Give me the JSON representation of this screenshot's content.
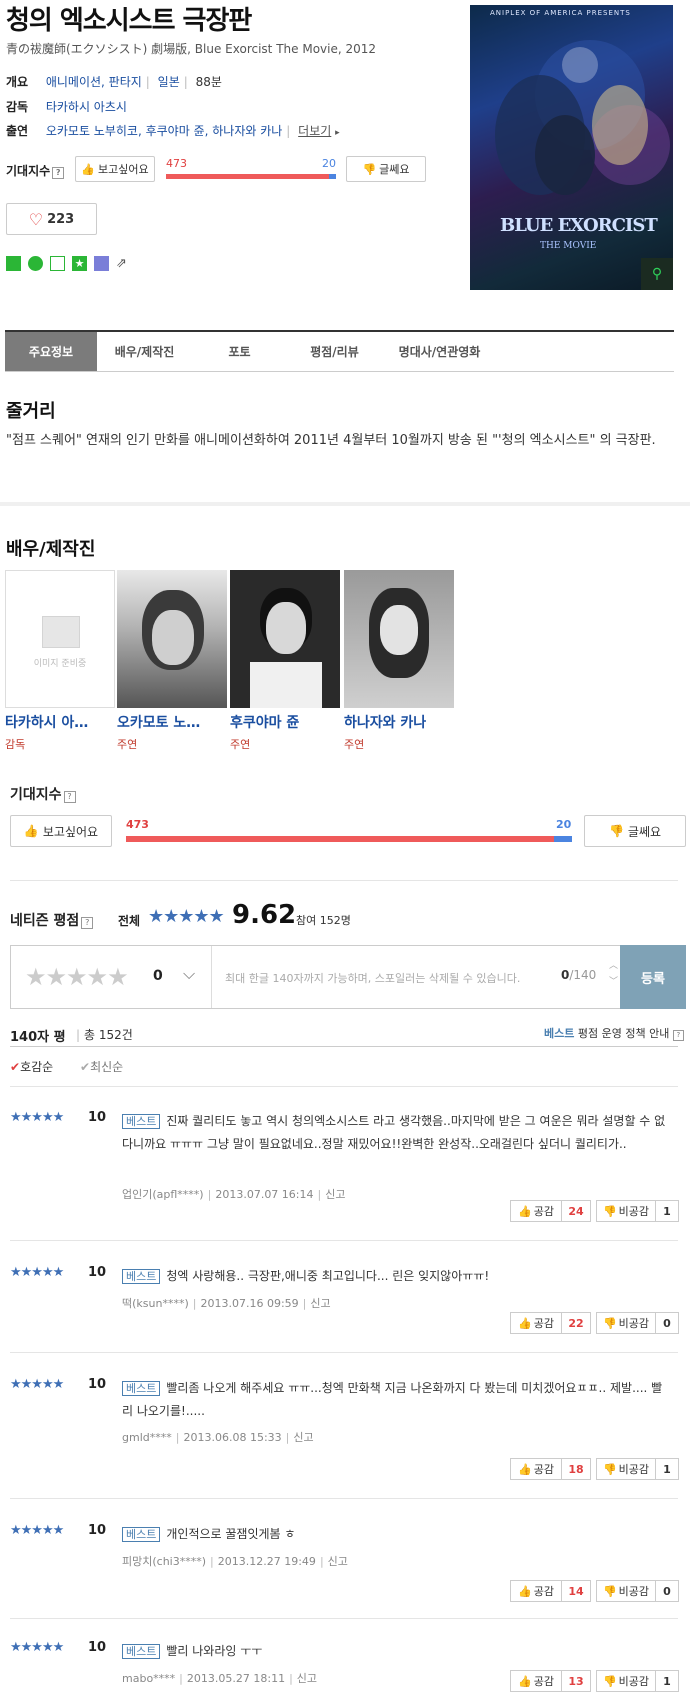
{
  "movie": {
    "title": "청의 엑소시스트 극장판",
    "subtitle": "青の祓魔師(エクソシスト) 劇場版, Blue Exorcist The Movie, 2012",
    "overview_label": "개요",
    "overview_genre": "애니메이션, 판타지",
    "overview_country": "일본",
    "overview_runtime": "88분",
    "director_label": "감독",
    "director": "타카하시 아츠시",
    "cast_label": "출연",
    "cast": "오카모토 노부히코, 후쿠야마 쥰, 하나자와 카나",
    "more_link": "더보기",
    "like_count": "223"
  },
  "expect": {
    "label": "기대지수",
    "want_label": "보고싶어요",
    "not_label": "글쎄요",
    "want_count": "473",
    "not_count": "20",
    "want_ratio": 0.959
  },
  "poster": {
    "top_text": "ANIPLEX OF AMERICA PRESENTS",
    "logo_text": "BLUE EXORCIST",
    "logo_sub": "THE MOVIE"
  },
  "tabs": [
    "주요정보",
    "배우/제작진",
    "포토",
    "평점/리뷰",
    "명대사/연관영화"
  ],
  "synopsis": {
    "title": "줄거리",
    "text": "\"점프 스퀘어\" 연재의 인기 만화를 애니메이션화하여 2011년 4월부터 10월까지 방송 된 \"'청의 엑소시스트\" 의 극장판."
  },
  "cast_section": {
    "title": "배우/제작진",
    "no_image_label": "이미지 준비중",
    "people": [
      {
        "name": "타카하시 아…",
        "role": "감독"
      },
      {
        "name": "오카모토 노…",
        "role": "주연"
      },
      {
        "name": "후쿠야마 쥰",
        "role": "주연"
      },
      {
        "name": "하나자와 카나",
        "role": "주연"
      }
    ]
  },
  "netizen": {
    "title": "네티즌 평점",
    "all_label": "전체",
    "score": "9.62",
    "participants_label": "참여 152명",
    "input_score": "0",
    "input_placeholder": "최대 한글 140자까지 가능하며, 스포일러는 삭제될 수 있습니다.",
    "char_count": "0",
    "char_max": "/140",
    "submit_label": "등록"
  },
  "review_list": {
    "title": "140자 평",
    "total": "총 152건",
    "policy_best": "베스트",
    "policy_label": "평점 운영 정책 안내",
    "sort_like": "호감순",
    "sort_recent": "최신순",
    "best_label": "베스트",
    "report_label": "신고",
    "agree_label": "공감",
    "disagree_label": "비공감",
    "items": [
      {
        "score": "10",
        "text": "진짜 퀄리티도 놓고 역시 청의엑소시스트 라고 생각했음..마지막에 받은 그 여운은 뭐라 설명할 수 없다니까요 ㅠㅠㅠ 그냥 말이 필요없네요..정말 재밌어요!!완벽한 완성작..오래걸린다 싶더니 퀄리티가..",
        "user": "업인기(apfl****)",
        "date": "2013.07.07 16:14",
        "agree": "24",
        "disagree": "1"
      },
      {
        "score": "10",
        "text": "청엑 사랑해용.. 극장판,애니중 최고입니다... 린은 잊지않아ㅠㅠ!",
        "user": "떡(ksun****)",
        "date": "2013.07.16 09:59",
        "agree": "22",
        "disagree": "0"
      },
      {
        "score": "10",
        "text": "빨리좀 나오게 해주세요 ㅠㅠ...청엑 만화책 지금 나온화까지 다 봤는데 미치겠어요ㅍㅍ.. 제발.... 빨리 나오기를!.....",
        "user": "gmld****",
        "date": "2013.06.08 15:33",
        "agree": "18",
        "disagree": "1"
      },
      {
        "score": "10",
        "text": "개인적으로 꿀잼잇게봄 ㅎ",
        "user": "피망치(chi3****)",
        "date": "2013.12.27 19:49",
        "agree": "14",
        "disagree": "0"
      },
      {
        "score": "10",
        "text": "빨리 나와라잉 ㅜㅜ",
        "user": "mabo****",
        "date": "2013.05.27 18:11",
        "agree": "13",
        "disagree": "1"
      }
    ]
  }
}
